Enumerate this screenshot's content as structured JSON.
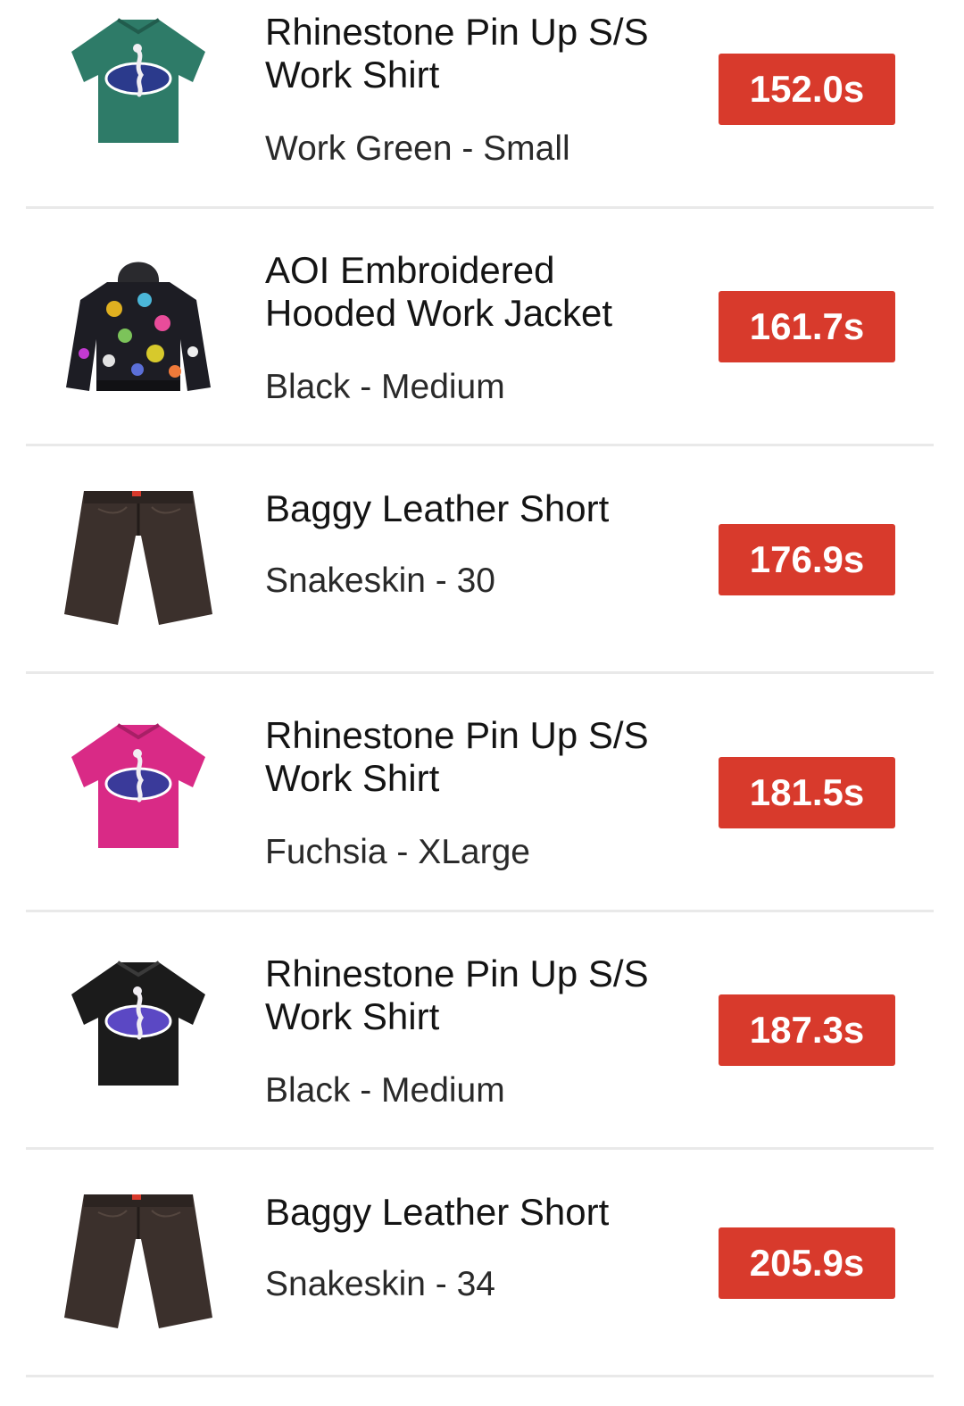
{
  "items": [
    {
      "name_line1": "Rhinestone Pin Up S/S",
      "name_line2": "Work Shirt",
      "variant": "Work Green - Small",
      "time": "152.0s",
      "image_icon": "green-work-shirt-icon",
      "image_color": "#2e7b68"
    },
    {
      "name_line1": "AOI Embroidered",
      "name_line2": "Hooded Work Jacket",
      "variant": "Black - Medium",
      "time": "161.7s",
      "image_icon": "patterned-hooded-jacket-icon",
      "image_color": "#1d1d24"
    },
    {
      "name_line1": "Baggy Leather Short",
      "name_line2": "",
      "variant": "Snakeskin - 30",
      "time": "176.9s",
      "image_icon": "leather-shorts-icon",
      "image_color": "#3b302c"
    },
    {
      "name_line1": "Rhinestone Pin Up S/S",
      "name_line2": "Work Shirt",
      "variant": "Fuchsia - XLarge",
      "time": "181.5s",
      "image_icon": "fuchsia-work-shirt-icon",
      "image_color": "#d92a86"
    },
    {
      "name_line1": "Rhinestone Pin Up S/S",
      "name_line2": "Work Shirt",
      "variant": "Black - Medium",
      "time": "187.3s",
      "image_icon": "black-work-shirt-icon",
      "image_color": "#1b1b1b"
    },
    {
      "name_line1": "Baggy Leather Short",
      "name_line2": "",
      "variant": "Snakeskin - 34",
      "time": "205.9s",
      "image_icon": "leather-shorts-icon",
      "image_color": "#3b302c"
    }
  ],
  "colors": {
    "badge": "#d83a2c",
    "divider": "#e9e9e9"
  }
}
